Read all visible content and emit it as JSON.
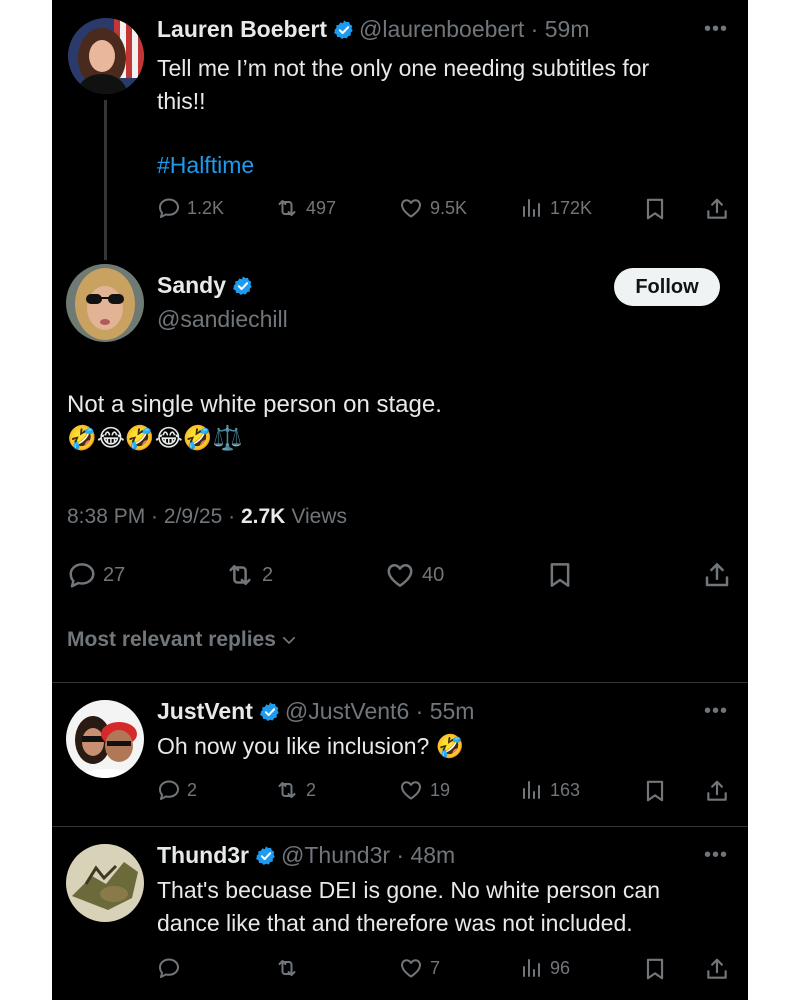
{
  "tweet1": {
    "author_name": "Lauren Boebert",
    "handle": "@laurenboebert",
    "time": "59m",
    "text_line1": "Tell me I’m not the only one needing subtitles for",
    "text_line2": "this!!",
    "hashtag": "#Halftime",
    "replies": "1.2K",
    "reposts": "497",
    "likes": "9.5K",
    "views": "172K"
  },
  "main": {
    "author_name": "Sandy",
    "handle": "@sandiechill",
    "follow_label": "Follow",
    "text": "Not a single white person on stage.",
    "emojis": "🤣😂🤣😂🤣⚖️",
    "time": "8:38 PM",
    "date": "2/9/25",
    "views_count": "2.7K",
    "views_label": "Views",
    "replies": "27",
    "reposts": "2",
    "likes": "40"
  },
  "replies_filter": "Most relevant replies",
  "reply1": {
    "author_name": "JustVent",
    "handle": "@JustVent6",
    "time": "55m",
    "text": "Oh now you like inclusion? 🤣",
    "replies": "2",
    "reposts": "2",
    "likes": "19",
    "views": "163"
  },
  "reply2": {
    "author_name": "Thund3r",
    "handle": "@Thund3r",
    "time": "48m",
    "text_line1": "That's becuase DEI is gone. No white person can",
    "text_line2": "dance like that and therefore was not included.",
    "replies": "",
    "reposts": "",
    "likes": "7",
    "views": "96"
  },
  "colors": {
    "background": "#000000",
    "accent": "#1d9bf0",
    "muted": "#71767b",
    "text": "#e7e9ea"
  },
  "icons": [
    "verified-badge-icon",
    "reply-icon",
    "repost-icon",
    "like-icon",
    "views-icon",
    "bookmark-icon",
    "share-icon",
    "more-icon",
    "chevron-down-icon"
  ]
}
